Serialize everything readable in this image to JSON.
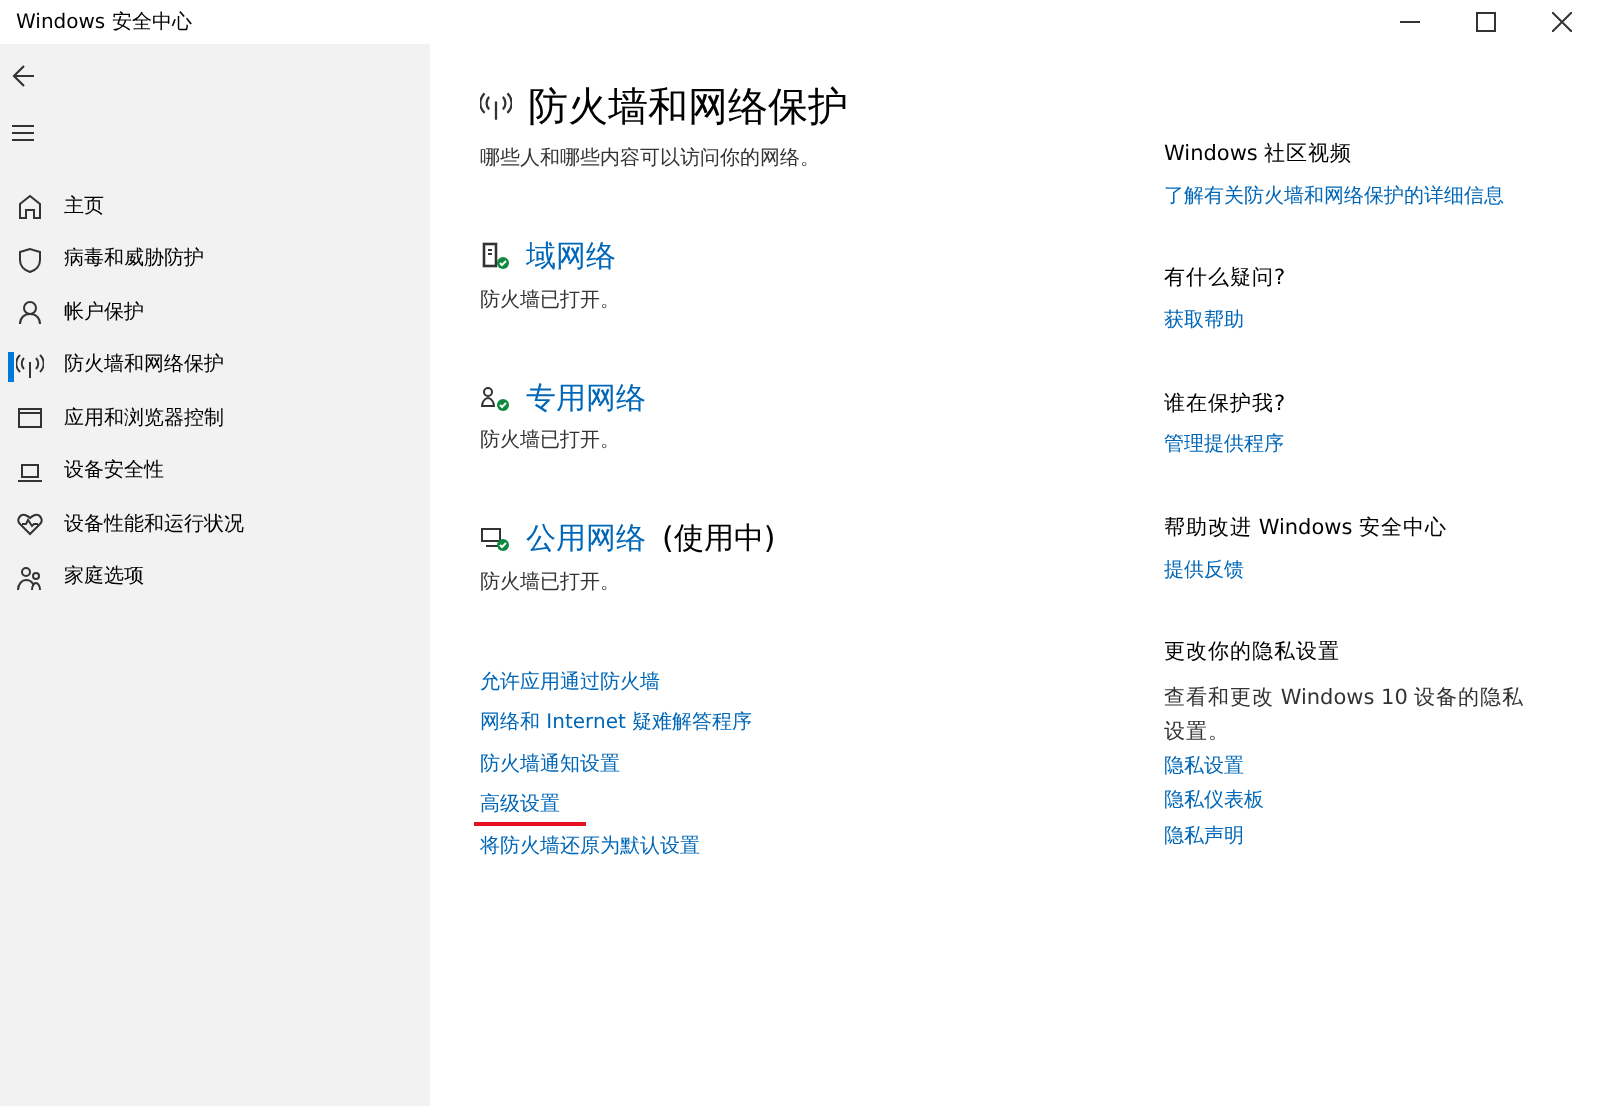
{
  "window": {
    "title": "Windows 安全中心"
  },
  "sidebar": {
    "items": [
      {
        "label": "主页",
        "selected": false
      },
      {
        "label": "病毒和威胁防护",
        "selected": false
      },
      {
        "label": "帐户保护",
        "selected": false
      },
      {
        "label": "防火墙和网络保护",
        "selected": true
      },
      {
        "label": "应用和浏览器控制",
        "selected": false
      },
      {
        "label": "设备安全性",
        "selected": false
      },
      {
        "label": "设备性能和运行状况",
        "selected": false
      },
      {
        "label": "家庭选项",
        "selected": false
      }
    ]
  },
  "main": {
    "title": "防火墙和网络保护",
    "subtitle": "哪些人和哪些内容可以访问你的网络。",
    "networks": [
      {
        "name": "域网络",
        "status": "防火墙已打开。"
      },
      {
        "name": "专用网络",
        "status": "防火墙已打开。"
      },
      {
        "name": "公用网络",
        "in_use": "(使用中)",
        "status": "防火墙已打开。"
      }
    ],
    "links": [
      {
        "label": "允许应用通过防火墙",
        "annotated": false
      },
      {
        "label": "网络和 Internet 疑难解答程序",
        "annotated": false
      },
      {
        "label": "防火墙通知设置",
        "annotated": false
      },
      {
        "label": "高级设置",
        "annotated": true
      },
      {
        "label": "将防火墙还原为默认设置",
        "annotated": false
      }
    ]
  },
  "aside": {
    "sections": [
      {
        "heading": "Windows 社区视频",
        "links": [
          "了解有关防火墙和网络保护的详细信息"
        ]
      },
      {
        "heading": "有什么疑问?",
        "links": [
          "获取帮助"
        ]
      },
      {
        "heading": "谁在保护我?",
        "links": [
          "管理提供程序"
        ]
      },
      {
        "heading": "帮助改进 Windows 安全中心",
        "links": [
          "提供反馈"
        ]
      },
      {
        "heading": "更改你的隐私设置",
        "text": "查看和更改 Windows 10 设备的隐私设置。",
        "links": [
          "隐私设置",
          "隐私仪表板",
          "隐私声明"
        ]
      }
    ]
  }
}
